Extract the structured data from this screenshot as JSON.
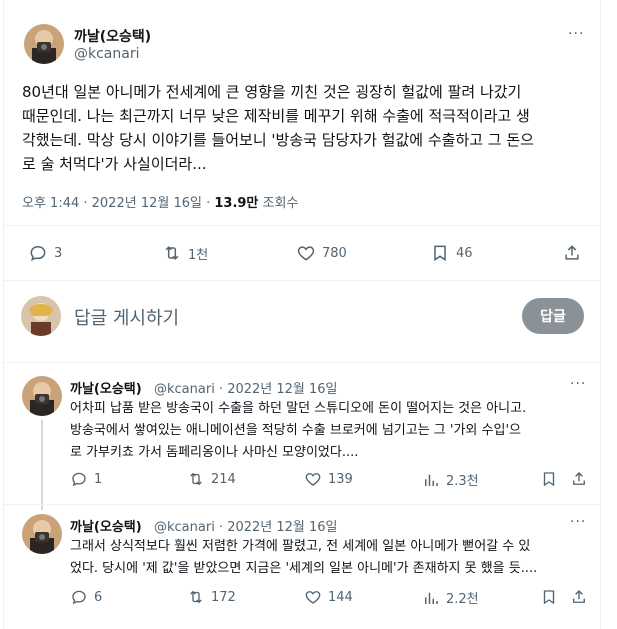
{
  "main": {
    "author_name": "까날(오승택)",
    "handle": "@kcanari",
    "more": "···",
    "lines": [
      "80년대 일본 아니메가 전세계에 큰 영향을 끼친 것은 굉장히 헐값에 팔려 나갔기",
      "때문인데. 나는 최근까지 너무 낮은 제작비를 메꾸기 위해 수출에 적극적이라고 생",
      "각했는데. 막상 당시 이야기를 들어보니 '방송국 담당자가 헐값에 수출하고 그 돈으",
      "로 술 처먹다'가 사실이더라..."
    ],
    "time": "오후 1:44 · 2022년 12월 16일 · ",
    "views_num": "13.9만",
    "views_label": " 조회수",
    "stats": {
      "replies": "3",
      "retweets": "1천",
      "likes": "780",
      "bookmarks": "46"
    }
  },
  "reply_box": {
    "placeholder": "답글 게시하기",
    "button": "답글"
  },
  "replies": [
    {
      "author_name": "까날(오승택)",
      "meta": "@kcanari · 2022년 12월 16일",
      "more": "···",
      "lines": [
        "어차피 납품 받은 방송국이 수출을 하던 말던 스튜디오에 돈이 떨어지는 것은 아니고.",
        "방송국에서 쌓여있는 애니메이션을 적당히 수출 브로커에 넘기고는 그 '가외 수입'으",
        "로 가부키쵸 가서 돔페리옹이나 사마신 모양이었다...."
      ],
      "stats": {
        "replies": "1",
        "retweets": "214",
        "likes": "139",
        "views": "2.3천"
      }
    },
    {
      "author_name": "까날(오승택)",
      "meta": "@kcanari · 2022년 12월 16일",
      "more": "···",
      "lines": [
        "그래서 상식적보다 훨씬 저렴한 가격에 팔렸고, 전 세계에 일본 아니메가 뻗어갈 수 있",
        "었다. 당시에 '제 값'을 받았으면 지금은 '세계의 일본 아니메'가 존재하지 못 했을 듯...."
      ],
      "stats": {
        "replies": "6",
        "retweets": "172",
        "likes": "144",
        "views": "2.2천"
      }
    }
  ],
  "colors": {
    "text": "#0f1419",
    "muted": "#536471",
    "border": "#eff3f4",
    "reply_button": "#8b9297"
  },
  "icons": [
    "reply-icon",
    "retweet-icon",
    "like-icon",
    "bookmark-icon",
    "share-icon",
    "views-icon",
    "more-icon"
  ]
}
